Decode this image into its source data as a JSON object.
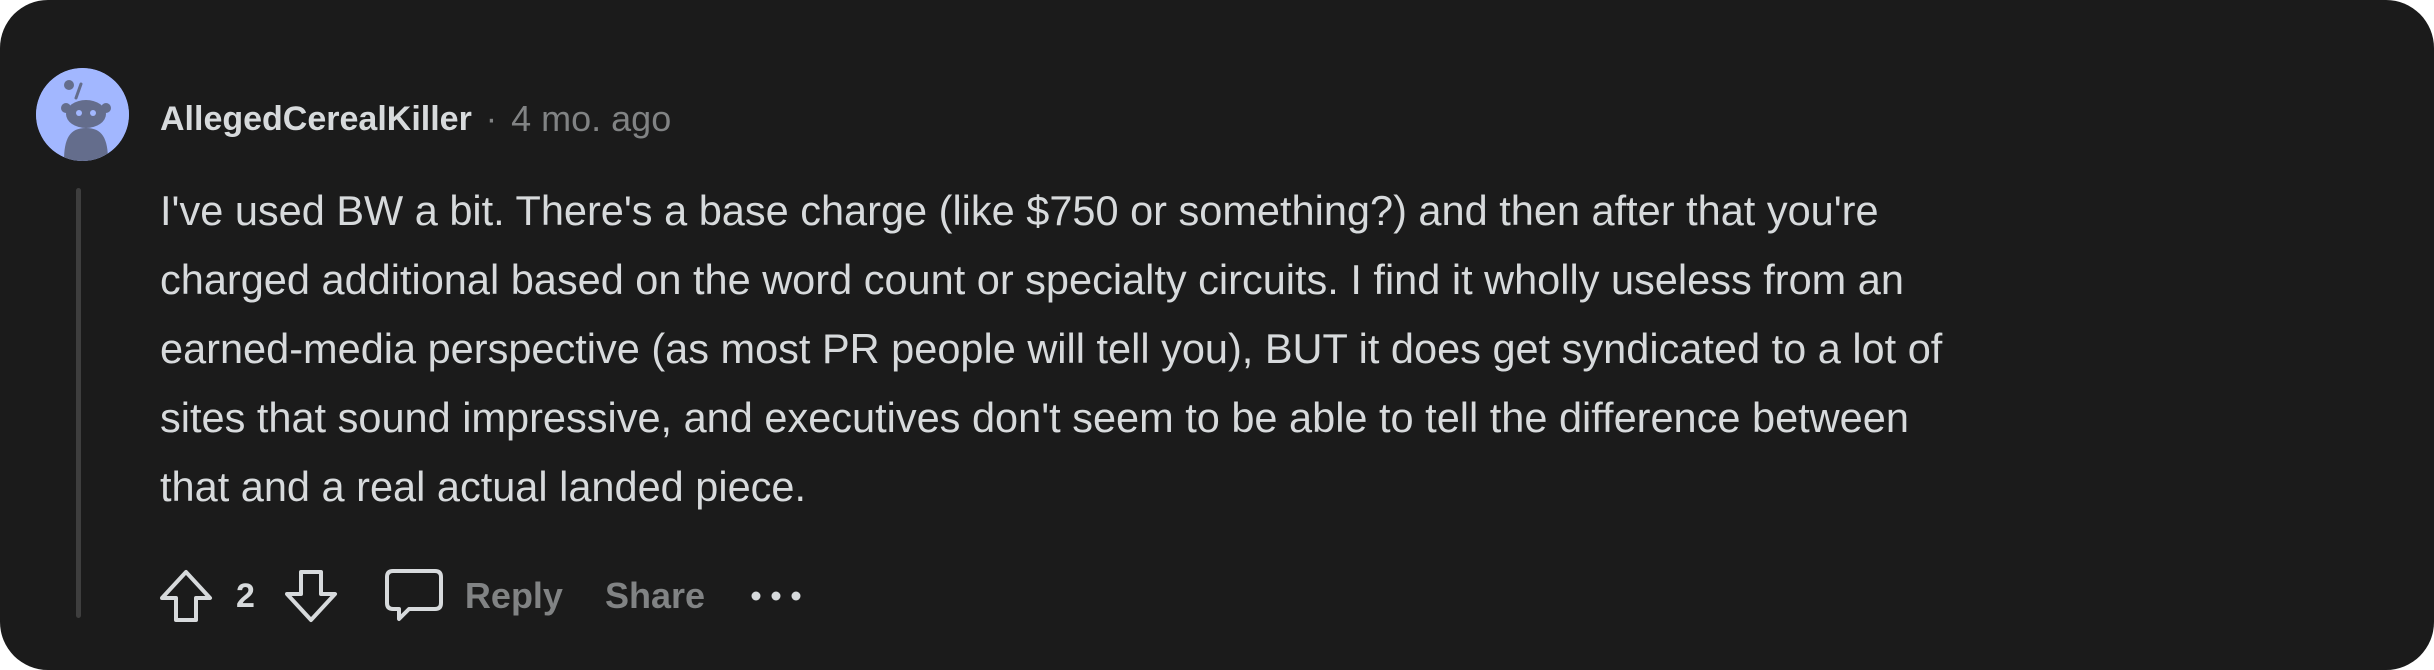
{
  "comment": {
    "author": "AllegedCerealKiller",
    "separator": "·",
    "timestamp": "4 mo. ago",
    "body_lines": [
      "I've used BW a bit. There's a base charge (like $750 or something?) and then after that you're",
      "charged additional based on the word count or specialty circuits. I find it wholly useless from an",
      "earned-media perspective (as most PR people will tell you), BUT it does get syndicated to a lot of",
      "sites that sound impressive, and executives don't seem to be able to tell the difference between",
      "that and a real actual landed piece."
    ],
    "score": "2"
  },
  "actions": {
    "reply_label": "Reply",
    "share_label": "Share",
    "more_label": "•••"
  },
  "icons": {
    "upvote": "upvote-arrow-icon",
    "downvote": "downvote-arrow-icon",
    "reply": "speech-bubble-icon",
    "more": "ellipsis-icon",
    "avatar": "snoo-avatar-icon"
  },
  "colors": {
    "card_background": "#1b1b1b",
    "text_primary": "#d7dadc",
    "text_secondary": "#818384",
    "avatar_background": "#a2b7ff",
    "thread_line": "#3e3e3e"
  }
}
